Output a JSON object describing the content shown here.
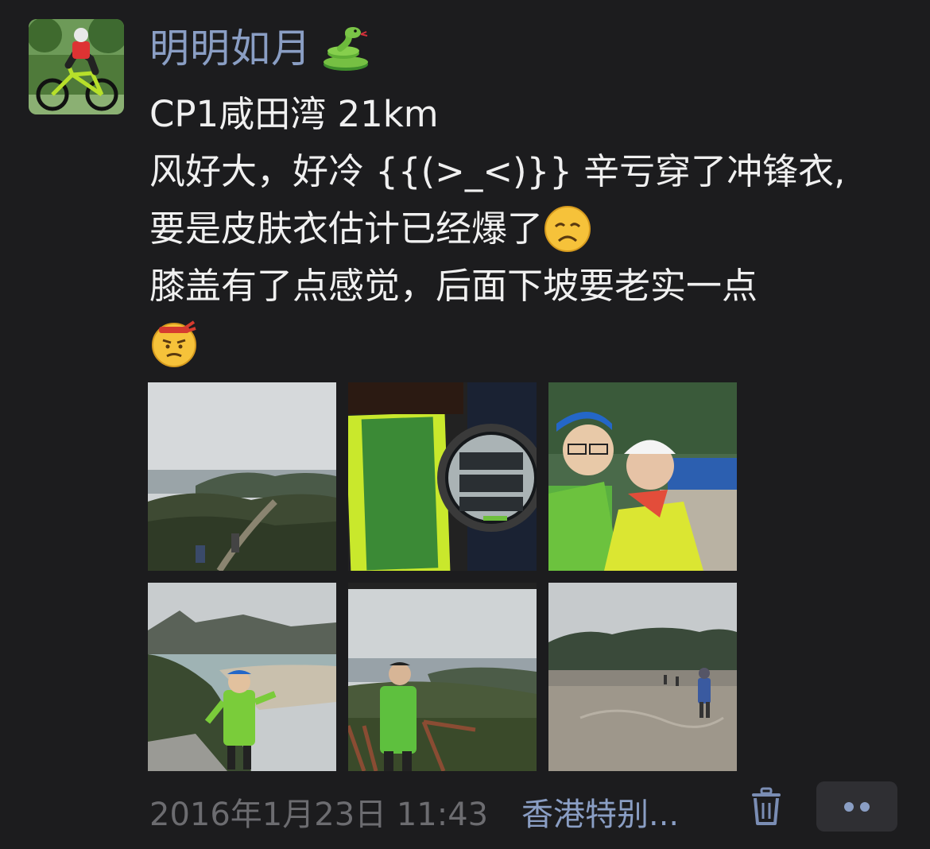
{
  "post": {
    "username": "明明如月",
    "username_emoji": "snake-icon",
    "lines": {
      "l1": "CP1咸田湾 21km",
      "l2": "风好大，好冷 {{(>_<)}} 辛亏穿了冲锋衣,",
      "l3": "要是皮肤衣估计已经爆了",
      "l4": "膝盖有了点感觉，后面下坡要老实一点"
    },
    "emojis": [
      "sad-face-icon",
      "annoyed-face-icon"
    ]
  },
  "photos": [
    {
      "name": "photo-hill-view"
    },
    {
      "name": "photo-watch"
    },
    {
      "name": "photo-selfie"
    },
    {
      "name": "photo-beach-runner"
    },
    {
      "name": "photo-runner-stairs"
    },
    {
      "name": "photo-beach-sand"
    }
  ],
  "footer": {
    "timestamp": "2016年1月23日 11:43",
    "location": "香港特别...",
    "delete_icon": "trash-icon",
    "more_icon": "more-dots-icon"
  },
  "colors": {
    "background": "#1c1c1e",
    "username": "#8a9ec4",
    "text": "#f0f0f0",
    "timestamp": "#6c6c70",
    "location": "#8a9ec4",
    "more_button_bg": "#2f2f33"
  }
}
